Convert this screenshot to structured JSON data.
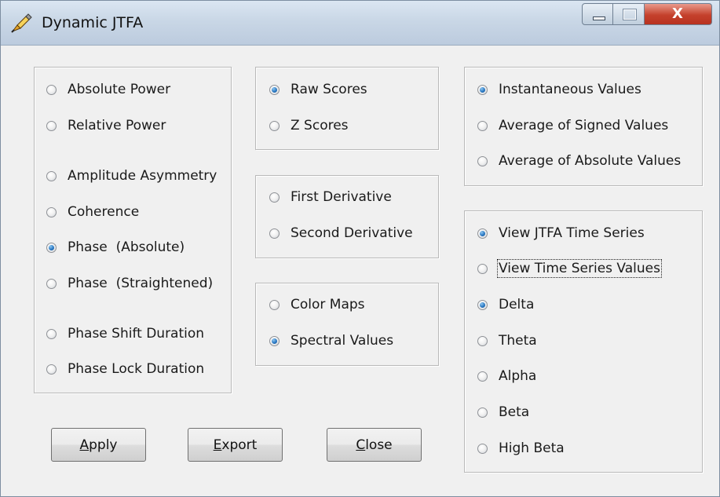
{
  "window": {
    "title": "Dynamic JTFA",
    "close_glyph": "X",
    "icon": "pen-app-icon"
  },
  "measure_group": {
    "options": [
      {
        "label": "Absolute Power",
        "checked": false
      },
      {
        "label": "Relative Power",
        "checked": false
      },
      {
        "label": "Amplitude Asymmetry",
        "checked": false
      },
      {
        "label": "Coherence",
        "checked": false
      },
      {
        "label": "Phase  (Absolute)",
        "checked": true
      },
      {
        "label": "Phase  (Straightened)",
        "checked": false
      },
      {
        "label": "Phase Shift Duration",
        "checked": false
      },
      {
        "label": "Phase Lock Duration",
        "checked": false
      }
    ]
  },
  "score_group": {
    "options": [
      {
        "label": "Raw Scores",
        "checked": true
      },
      {
        "label": "Z Scores",
        "checked": false
      }
    ]
  },
  "derivative_group": {
    "options": [
      {
        "label": "First Derivative",
        "checked": false
      },
      {
        "label": "Second Derivative",
        "checked": false
      }
    ]
  },
  "display_group": {
    "options": [
      {
        "label": "Color Maps",
        "checked": false
      },
      {
        "label": "Spectral Values",
        "checked": true
      }
    ]
  },
  "values_group": {
    "options": [
      {
        "label": "Instantaneous Values",
        "checked": true
      },
      {
        "label": "Average of Signed Values",
        "checked": false
      },
      {
        "label": "Average of Absolute Values",
        "checked": false
      }
    ]
  },
  "view_group": {
    "options": [
      {
        "label": "View JTFA Time Series",
        "checked": true
      },
      {
        "label": "View Time Series Values",
        "checked": false,
        "focused": true
      },
      {
        "label": "Delta",
        "checked": true
      },
      {
        "label": "Theta",
        "checked": false
      },
      {
        "label": "Alpha",
        "checked": false
      },
      {
        "label": "Beta",
        "checked": false
      },
      {
        "label": "High Beta",
        "checked": false
      }
    ]
  },
  "buttons": {
    "apply": {
      "label": "Apply",
      "accel": "A",
      "rest": "pply"
    },
    "export": {
      "label": "Export",
      "accel": "E",
      "rest": "xport"
    },
    "close": {
      "label": "Close",
      "accel": "C",
      "rest": "lose"
    }
  },
  "colors": {
    "radio_selected": "#2c7ac4",
    "close_button": "#c4412c",
    "dialog_bg": "#f0f0f0"
  }
}
